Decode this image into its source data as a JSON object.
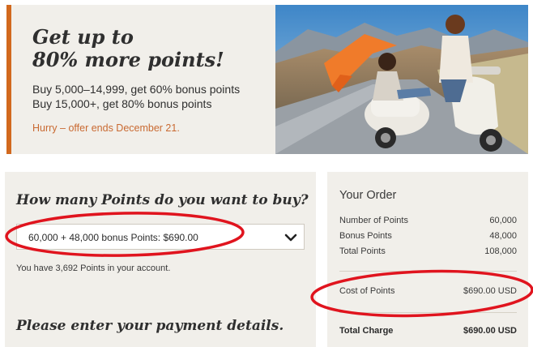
{
  "colors": {
    "accent": "#d2691e",
    "hurry_text": "#c96a32",
    "annotation": "#e0141e",
    "panel_bg": "#f1efea"
  },
  "promo": {
    "headline_line1": "Get up to",
    "headline_line2": "80% more points!",
    "line1": "Buy 5,000–14,999, get 60% bonus points",
    "line2": "Buy 15,000+, get 80% bonus points",
    "hurry": "Hurry – offer ends December 21."
  },
  "purchase": {
    "title": "How many Points do you want to buy?",
    "selected_option": "60,000 + 48,000 bonus Points: $690.00",
    "balance_text": "You have 3,692 Points in your account.",
    "payment_title": "Please enter your payment details."
  },
  "order": {
    "title": "Your Order",
    "rows": [
      {
        "label": "Number of Points",
        "value": "60,000"
      },
      {
        "label": "Bonus Points",
        "value": "48,000"
      },
      {
        "label": "Total Points",
        "value": "108,000"
      }
    ],
    "cost_label": "Cost of Points",
    "cost_value": "$690.00 USD",
    "total_label": "Total Charge",
    "total_value": "$690.00 USD"
  },
  "icons": {
    "select_chevron": "chevron-down-icon"
  }
}
